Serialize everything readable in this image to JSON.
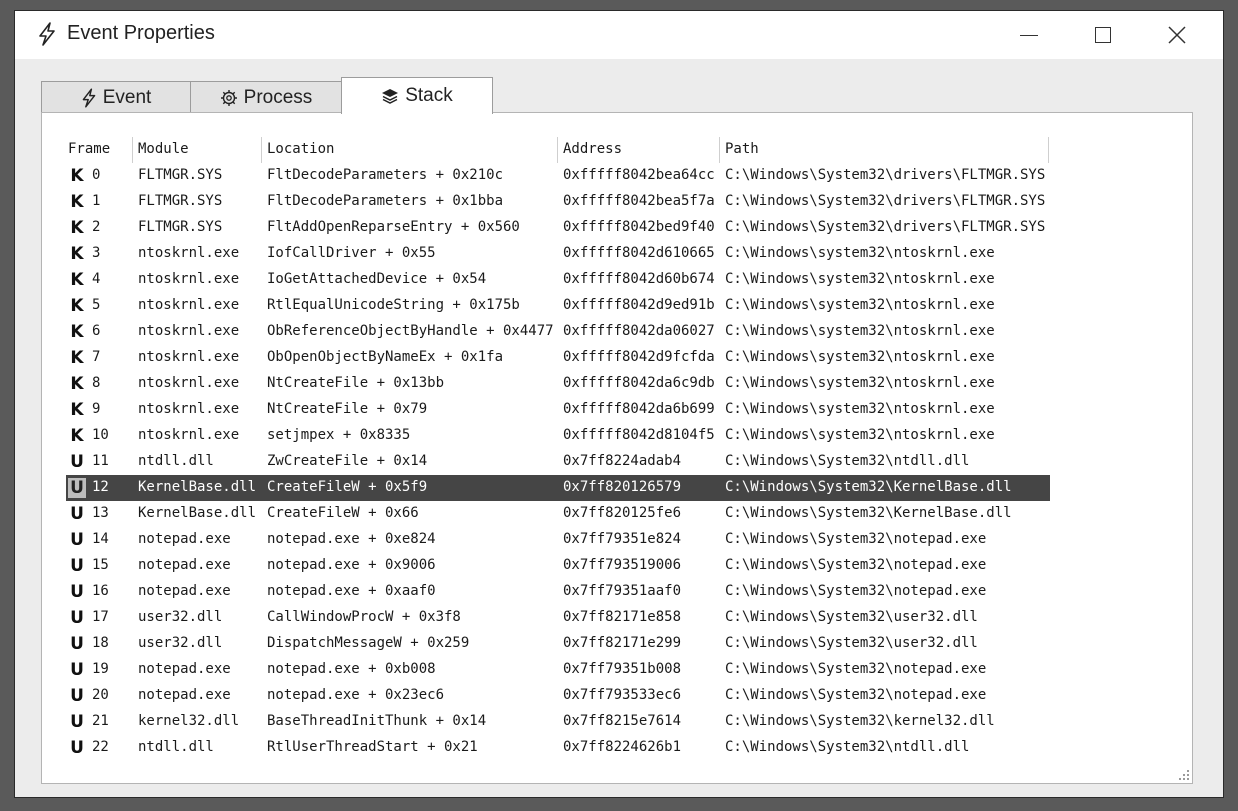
{
  "window": {
    "title": "Event Properties",
    "icon": "lightning-icon",
    "controls": {
      "minimize": "minimize-icon",
      "maximize": "maximize-icon",
      "close": "close-icon"
    }
  },
  "tabs": [
    {
      "label": "Event",
      "icon": "lightning-icon",
      "active": false
    },
    {
      "label": "Process",
      "icon": "gear-icon",
      "active": false
    },
    {
      "label": "Stack",
      "icon": "layers-icon",
      "active": true
    }
  ],
  "stack": {
    "columns": [
      "Frame",
      "Module",
      "Location",
      "Address",
      "Path"
    ],
    "selected_frame": 12,
    "rows": [
      {
        "mode": "K",
        "frame": "0",
        "module": "FLTMGR.SYS",
        "location": "FltDecodeParameters + 0x210c",
        "address": "0xfffff8042bea64cc",
        "path": "C:\\Windows\\System32\\drivers\\FLTMGR.SYS"
      },
      {
        "mode": "K",
        "frame": "1",
        "module": "FLTMGR.SYS",
        "location": "FltDecodeParameters + 0x1bba",
        "address": "0xfffff8042bea5f7a",
        "path": "C:\\Windows\\System32\\drivers\\FLTMGR.SYS"
      },
      {
        "mode": "K",
        "frame": "2",
        "module": "FLTMGR.SYS",
        "location": "FltAddOpenReparseEntry + 0x560",
        "address": "0xfffff8042bed9f40",
        "path": "C:\\Windows\\System32\\drivers\\FLTMGR.SYS"
      },
      {
        "mode": "K",
        "frame": "3",
        "module": "ntoskrnl.exe",
        "location": "IofCallDriver + 0x55",
        "address": "0xfffff8042d610665",
        "path": "C:\\Windows\\system32\\ntoskrnl.exe"
      },
      {
        "mode": "K",
        "frame": "4",
        "module": "ntoskrnl.exe",
        "location": "IoGetAttachedDevice + 0x54",
        "address": "0xfffff8042d60b674",
        "path": "C:\\Windows\\system32\\ntoskrnl.exe"
      },
      {
        "mode": "K",
        "frame": "5",
        "module": "ntoskrnl.exe",
        "location": "RtlEqualUnicodeString + 0x175b",
        "address": "0xfffff8042d9ed91b",
        "path": "C:\\Windows\\system32\\ntoskrnl.exe"
      },
      {
        "mode": "K",
        "frame": "6",
        "module": "ntoskrnl.exe",
        "location": "ObReferenceObjectByHandle + 0x4477",
        "address": "0xfffff8042da06027",
        "path": "C:\\Windows\\system32\\ntoskrnl.exe"
      },
      {
        "mode": "K",
        "frame": "7",
        "module": "ntoskrnl.exe",
        "location": "ObOpenObjectByNameEx + 0x1fa",
        "address": "0xfffff8042d9fcfda",
        "path": "C:\\Windows\\system32\\ntoskrnl.exe"
      },
      {
        "mode": "K",
        "frame": "8",
        "module": "ntoskrnl.exe",
        "location": "NtCreateFile + 0x13bb",
        "address": "0xfffff8042da6c9db",
        "path": "C:\\Windows\\system32\\ntoskrnl.exe"
      },
      {
        "mode": "K",
        "frame": "9",
        "module": "ntoskrnl.exe",
        "location": "NtCreateFile + 0x79",
        "address": "0xfffff8042da6b699",
        "path": "C:\\Windows\\system32\\ntoskrnl.exe"
      },
      {
        "mode": "K",
        "frame": "10",
        "module": "ntoskrnl.exe",
        "location": "setjmpex + 0x8335",
        "address": "0xfffff8042d8104f5",
        "path": "C:\\Windows\\system32\\ntoskrnl.exe"
      },
      {
        "mode": "U",
        "frame": "11",
        "module": "ntdll.dll",
        "location": "ZwCreateFile + 0x14",
        "address": "0x7ff8224adab4",
        "path": "C:\\Windows\\System32\\ntdll.dll"
      },
      {
        "mode": "U",
        "frame": "12",
        "module": "KernelBase.dll",
        "location": "CreateFileW + 0x5f9",
        "address": "0x7ff820126579",
        "path": "C:\\Windows\\System32\\KernelBase.dll"
      },
      {
        "mode": "U",
        "frame": "13",
        "module": "KernelBase.dll",
        "location": "CreateFileW + 0x66",
        "address": "0x7ff820125fe6",
        "path": "C:\\Windows\\System32\\KernelBase.dll"
      },
      {
        "mode": "U",
        "frame": "14",
        "module": "notepad.exe",
        "location": "notepad.exe + 0xe824",
        "address": "0x7ff79351e824",
        "path": "C:\\Windows\\System32\\notepad.exe"
      },
      {
        "mode": "U",
        "frame": "15",
        "module": "notepad.exe",
        "location": "notepad.exe + 0x9006",
        "address": "0x7ff793519006",
        "path": "C:\\Windows\\System32\\notepad.exe"
      },
      {
        "mode": "U",
        "frame": "16",
        "module": "notepad.exe",
        "location": "notepad.exe + 0xaaf0",
        "address": "0x7ff79351aaf0",
        "path": "C:\\Windows\\System32\\notepad.exe"
      },
      {
        "mode": "U",
        "frame": "17",
        "module": "user32.dll",
        "location": "CallWindowProcW + 0x3f8",
        "address": "0x7ff82171e858",
        "path": "C:\\Windows\\System32\\user32.dll"
      },
      {
        "mode": "U",
        "frame": "18",
        "module": "user32.dll",
        "location": "DispatchMessageW + 0x259",
        "address": "0x7ff82171e299",
        "path": "C:\\Windows\\System32\\user32.dll"
      },
      {
        "mode": "U",
        "frame": "19",
        "module": "notepad.exe",
        "location": "notepad.exe + 0xb008",
        "address": "0x7ff79351b008",
        "path": "C:\\Windows\\System32\\notepad.exe"
      },
      {
        "mode": "U",
        "frame": "20",
        "module": "notepad.exe",
        "location": "notepad.exe + 0x23ec6",
        "address": "0x7ff793533ec6",
        "path": "C:\\Windows\\System32\\notepad.exe"
      },
      {
        "mode": "U",
        "frame": "21",
        "module": "kernel32.dll",
        "location": "BaseThreadInitThunk + 0x14",
        "address": "0x7ff8215e7614",
        "path": "C:\\Windows\\System32\\kernel32.dll"
      },
      {
        "mode": "U",
        "frame": "22",
        "module": "ntdll.dll",
        "location": "RtlUserThreadStart + 0x21",
        "address": "0x7ff8224626b1",
        "path": "C:\\Windows\\System32\\ntdll.dll"
      }
    ]
  },
  "colors": {
    "selection": "#454545",
    "background": "#ececec",
    "panel": "#ffffff"
  }
}
